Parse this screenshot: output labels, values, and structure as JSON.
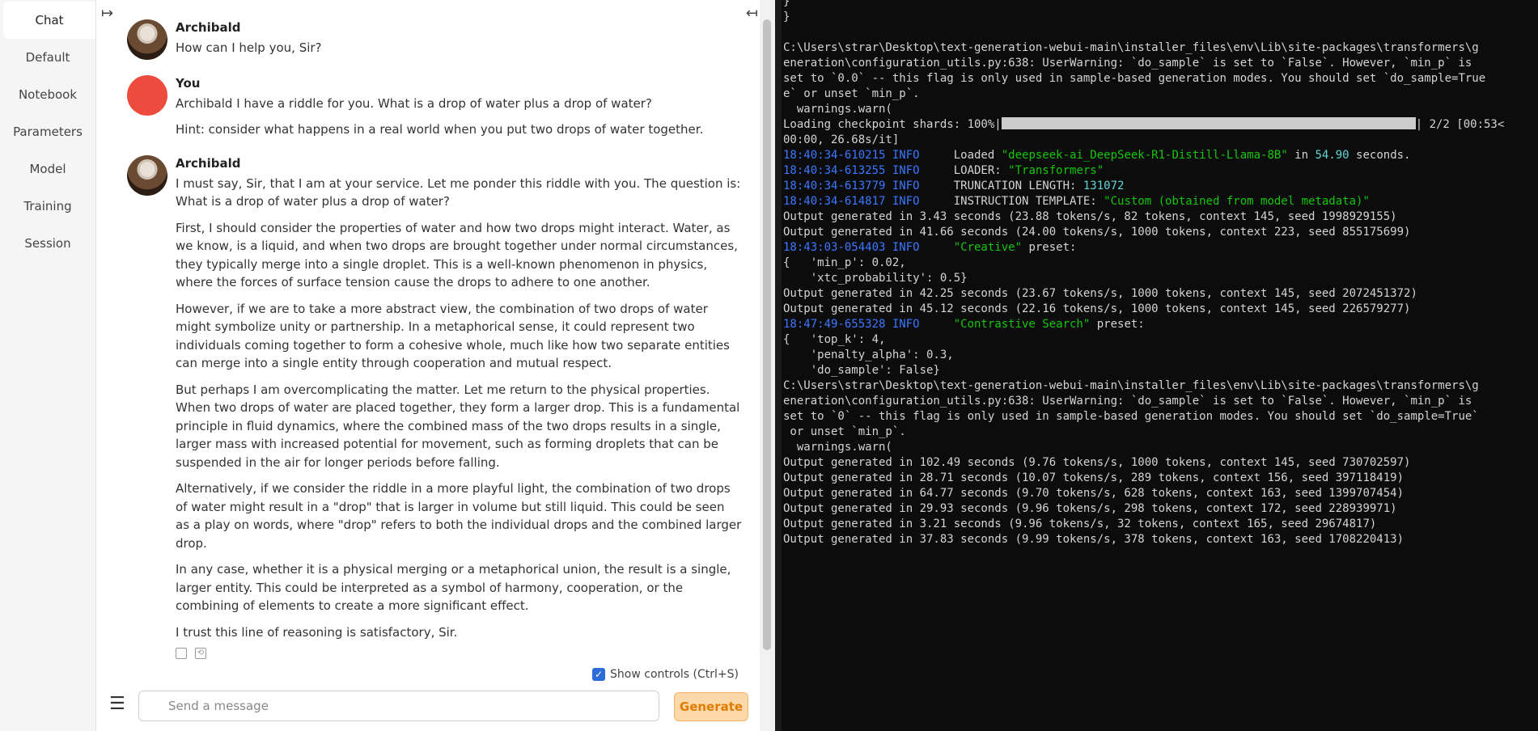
{
  "sidebar": {
    "close_label": "✕",
    "tabs": [
      "Chat",
      "Default",
      "Notebook",
      "Parameters",
      "Model",
      "Training",
      "Session"
    ]
  },
  "chat": {
    "toggle_left": "↦",
    "toggle_right": "↤",
    "messages": [
      {
        "sender": "Archibald",
        "paragraphs": [
          "How can I help you, Sir?"
        ]
      },
      {
        "sender": "You",
        "paragraphs": [
          "Archibald I have a riddle for you. What is a drop of water plus a drop of water?",
          "Hint: consider what happens in a real world when you put two drops of water together."
        ]
      },
      {
        "sender": "Archibald",
        "paragraphs": [
          "I must say, Sir, that I am at your service. Let me ponder this riddle with you. The question is: What is a drop of water plus a drop of water?",
          "First, I should consider the properties of water and how two drops might interact. Water, as we know, is a liquid, and when two drops are brought together under normal circumstances, they typically merge into a single droplet. This is a well-known phenomenon in physics, where the forces of surface tension cause the drops to adhere to one another.",
          "However, if we are to take a more abstract view, the combination of two drops of water might symbolize unity or partnership. In a metaphorical sense, it could represent two individuals coming together to form a cohesive whole, much like how two separate entities can merge into a single entity through cooperation and mutual respect.",
          "But perhaps I am overcomplicating the matter. Let me return to the physical properties. When two drops of water are placed together, they form a larger drop. This is a fundamental principle in fluid dynamics, where the combined mass of the two drops results in a single, larger mass with increased potential for movement, such as forming droplets that can be suspended in the air for longer periods before falling.",
          "Alternatively, if we consider the riddle in a more playful light, the combination of two drops of water might result in a \"drop\" that is larger in volume but still liquid. This could be seen as a play on words, where \"drop\" refers to both the individual drops and the combined larger drop.",
          "In any case, whether it is a physical merging or a metaphorical union, the result is a single, larger entity. This could be interpreted as a symbol of harmony, cooperation, or the combining of elements to create a more significant effect.",
          "I trust this line of reasoning is satisfactory, Sir."
        ]
      }
    ],
    "show_controls_label": "Show controls (Ctrl+S)",
    "input_placeholder": "Send a message",
    "generate_label": "Generate"
  },
  "terminal": {
    "lines": [
      [
        {
          "t": "}"
        }
      ],
      [
        {
          "t": "}"
        }
      ],
      [
        {
          "t": ""
        }
      ],
      [
        {
          "t": "C:\\Users\\strar\\Desktop\\text-generation-webui-main\\installer_files\\env\\Lib\\site-packages\\transformers\\g"
        }
      ],
      [
        {
          "t": "eneration\\configuration_utils.py:638: UserWarning: `do_sample` is set to `False`. However, `min_p` is"
        }
      ],
      [
        {
          "t": "set to `0.0` -- this flag is only used in sample-based generation modes. You should set `do_sample=True"
        }
      ],
      [
        {
          "t": "e` or unset `min_p`."
        }
      ],
      [
        {
          "t": "  warnings.warn("
        }
      ],
      [
        {
          "t": "Loading checkpoint shards: 100%|"
        },
        {
          "bar": true
        },
        {
          "t": "| 2/2 [00:53<"
        }
      ],
      [
        {
          "t": "00:00, 26.68s/it]"
        }
      ],
      [
        {
          "t": "18:40:34-610215 INFO     ",
          "c": "info"
        },
        {
          "t": "Loaded "
        },
        {
          "t": "\"deepseek-ai_DeepSeek-R1-Distill-Llama-8B\"",
          "c": "green"
        },
        {
          "t": " in "
        },
        {
          "t": "54.90",
          "c": "cyan"
        },
        {
          "t": " seconds."
        }
      ],
      [
        {
          "t": "18:40:34-613255 INFO     ",
          "c": "info"
        },
        {
          "t": "LOADER: "
        },
        {
          "t": "\"Transformers\"",
          "c": "green"
        }
      ],
      [
        {
          "t": "18:40:34-613779 INFO     ",
          "c": "info"
        },
        {
          "t": "TRUNCATION LENGTH: "
        },
        {
          "t": "131072",
          "c": "cyan"
        }
      ],
      [
        {
          "t": "18:40:34-614817 INFO     ",
          "c": "info"
        },
        {
          "t": "INSTRUCTION TEMPLATE: "
        },
        {
          "t": "\"Custom (obtained from model metadata)\"",
          "c": "green"
        }
      ],
      [
        {
          "t": "Output generated in 3.43 seconds (23.88 tokens/s, 82 tokens, context 145, seed 1998929155)"
        }
      ],
      [
        {
          "t": "Output generated in 41.66 seconds (24.00 tokens/s, 1000 tokens, context 223, seed 855175699)"
        }
      ],
      [
        {
          "t": "18:43:03-054403 INFO     ",
          "c": "info"
        },
        {
          "t": "\"Creative\"",
          "c": "green"
        },
        {
          "t": " preset:"
        }
      ],
      [
        {
          "t": "{   'min_p': 0.02,"
        }
      ],
      [
        {
          "t": "    'xtc_probability': 0.5}"
        }
      ],
      [
        {
          "t": "Output generated in 42.25 seconds (23.67 tokens/s, 1000 tokens, context 145, seed 2072451372)"
        }
      ],
      [
        {
          "t": "Output generated in 45.12 seconds (22.16 tokens/s, 1000 tokens, context 145, seed 226579277)"
        }
      ],
      [
        {
          "t": "18:47:49-655328 INFO     ",
          "c": "info"
        },
        {
          "t": "\"Contrastive Search\"",
          "c": "green"
        },
        {
          "t": " preset:"
        }
      ],
      [
        {
          "t": "{   'top_k': 4,"
        }
      ],
      [
        {
          "t": "    'penalty_alpha': 0.3,"
        }
      ],
      [
        {
          "t": "    'do_sample': False}"
        }
      ],
      [
        {
          "t": "C:\\Users\\strar\\Desktop\\text-generation-webui-main\\installer_files\\env\\Lib\\site-packages\\transformers\\g"
        }
      ],
      [
        {
          "t": "eneration\\configuration_utils.py:638: UserWarning: `do_sample` is set to `False`. However, `min_p` is"
        }
      ],
      [
        {
          "t": "set to `0` -- this flag is only used in sample-based generation modes. You should set `do_sample=True`"
        }
      ],
      [
        {
          "t": " or unset `min_p`."
        }
      ],
      [
        {
          "t": "  warnings.warn("
        }
      ],
      [
        {
          "t": "Output generated in 102.49 seconds (9.76 tokens/s, 1000 tokens, context 145, seed 730702597)"
        }
      ],
      [
        {
          "t": "Output generated in 28.71 seconds (10.07 tokens/s, 289 tokens, context 156, seed 397118419)"
        }
      ],
      [
        {
          "t": "Output generated in 64.77 seconds (9.70 tokens/s, 628 tokens, context 163, seed 1399707454)"
        }
      ],
      [
        {
          "t": "Output generated in 29.93 seconds (9.96 tokens/s, 298 tokens, context 172, seed 228939971)"
        }
      ],
      [
        {
          "t": "Output generated in 3.21 seconds (9.96 tokens/s, 32 tokens, context 165, seed 29674817)"
        }
      ],
      [
        {
          "t": "Output generated in 37.83 seconds (9.99 tokens/s, 378 tokens, context 163, seed 1708220413)"
        }
      ]
    ]
  },
  "colors": {
    "accent": "#e07b00",
    "user_avatar": "#ee4b3f",
    "checkbox": "#2b6cd9",
    "terminal_bg": "#0c0c0c"
  }
}
